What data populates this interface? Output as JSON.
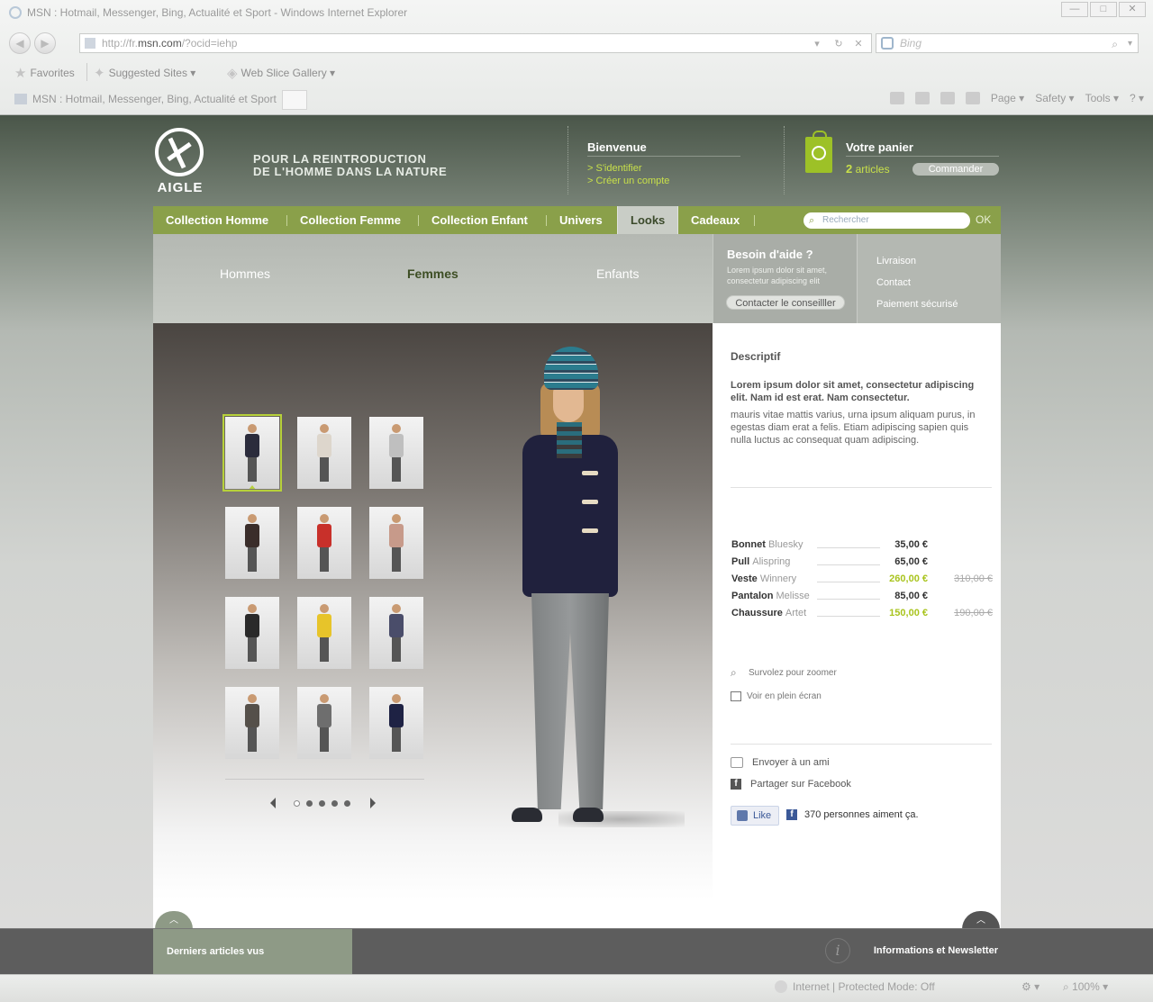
{
  "browser": {
    "title": "MSN : Hotmail, Messenger, Bing, Actualité et Sport - Windows Internet Explorer",
    "window_buttons": [
      "—",
      "□",
      "✕"
    ],
    "url_prefix": "http://fr.",
    "url_host": "msn.com",
    "url_suffix": "/?ocid=iehp",
    "search_placeholder": "Bing",
    "favorites_label": "Favorites",
    "suggested_sites": "Suggested Sites ▾",
    "web_slice": "Web Slice Gallery ▾",
    "tab_label": "MSN : Hotmail, Messenger, Bing, Actualité et Sport",
    "command_bar": {
      "page": "Page ▾",
      "safety": "Safety ▾",
      "tools": "Tools ▾",
      "help": "? ▾"
    },
    "status": {
      "zone": "Internet | Protected Mode: Off",
      "zoom": "100%"
    }
  },
  "site": {
    "brand": "AIGLE",
    "tagline_line1": "POUR LA REINTRODUCTION",
    "tagline_line2": "DE L'HOMME DANS LA NATURE",
    "welcome": {
      "title": "Bienvenue",
      "login": "> S'identifier",
      "register": "> Créer un compte"
    },
    "cart": {
      "title": "Votre panier",
      "count": "2",
      "count_label": "articles",
      "order_button": "Commander"
    },
    "nav": {
      "items": [
        "Collection Homme",
        "Collection Femme",
        "Collection Enfant",
        "Univers",
        "Looks",
        "Cadeaux"
      ],
      "active": "Looks",
      "search_placeholder": "Rechercher",
      "ok": "OK"
    },
    "subnav": {
      "men": "Hommes",
      "women": "Femmes",
      "kids": "Enfants",
      "active": "Femmes"
    },
    "help": {
      "title": "Besoin d'aide ?",
      "text": "Lorem ipsum dolor sit amet, consectetur adipiscing elit",
      "button": "Contacter le conseilller"
    },
    "links": [
      "Livraison",
      "Contact",
      "Paiement sécurisé"
    ],
    "gallery": {
      "thumbnail_count": 12,
      "active_index": 0,
      "pages": 5,
      "active_page": 0
    },
    "product": {
      "desc_title": "Descriptif",
      "desc_lead": "Lorem ipsum dolor sit amet, consectetur adipiscing elit. Nam id est erat. Nam consectetur.",
      "desc_body": "mauris vitae mattis varius, urna ipsum aliquam purus, in egestas diam erat a felis. Etiam adipiscing sapien quis nulla luctus ac consequat quam adipiscing.",
      "items": [
        {
          "type": "Bonnet",
          "name": "Bluesky",
          "price": "35,00 €",
          "old_price": "",
          "sale": false
        },
        {
          "type": "Pull",
          "name": "Alispring",
          "price": "65,00 €",
          "old_price": "",
          "sale": false
        },
        {
          "type": "Veste",
          "name": "Winnery",
          "price": "260,00 €",
          "old_price": "310,00 €",
          "sale": true
        },
        {
          "type": "Pantalon",
          "name": "Melisse",
          "price": "85,00 €",
          "old_price": "",
          "sale": false
        },
        {
          "type": "Chaussure",
          "name": "Artet",
          "price": "150,00 €",
          "old_price": "190,00 €",
          "sale": true
        }
      ],
      "zoom_hint": "Survolez pour zoomer",
      "fullscreen": "Voir en plein écran",
      "send_friend": "Envoyer à un ami",
      "share_facebook": "Partager sur Facebook",
      "like_button": "Like",
      "like_count": "370 personnes aiment ça."
    },
    "footer": {
      "recent": "Derniers articles vus",
      "info": "Informations et Newsletter"
    },
    "colors": {
      "accent_green": "#8aa04a",
      "lime": "#c8e04a",
      "sale": "#a9c41e"
    }
  }
}
